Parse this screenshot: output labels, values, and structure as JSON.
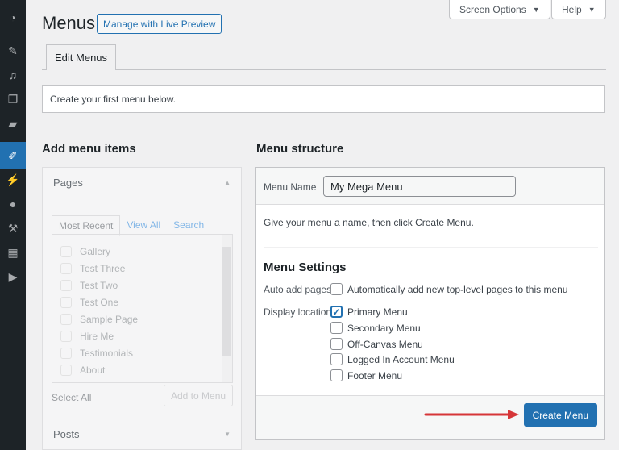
{
  "sidebar": {
    "items": [
      "dashboard-icon",
      "pin-icon",
      "media-icon",
      "pages-icon",
      "comments-icon",
      "appearance-icon",
      "plugins-icon",
      "users-icon",
      "tools-icon",
      "settings-icon",
      "play-icon"
    ]
  },
  "header": {
    "title": "Menus",
    "live_preview": "Manage with Live Preview",
    "screen_options": "Screen Options",
    "help": "Help"
  },
  "tabs": {
    "edit": "Edit Menus"
  },
  "notice": "Create your first menu below.",
  "add_items": {
    "title": "Add menu items",
    "pages": "Pages",
    "tabs": [
      "Most Recent",
      "View All",
      "Search"
    ],
    "pages_list": [
      "Gallery",
      "Test Three",
      "Test Two",
      "Test One",
      "Sample Page",
      "Hire Me",
      "Testimonials",
      "About"
    ],
    "select_all": "Select All",
    "add_to_menu": "Add to Menu",
    "posts": "Posts"
  },
  "structure": {
    "title": "Menu structure",
    "name_label": "Menu Name",
    "name_value": "My Mega Menu",
    "hint": "Give your menu a name, then click Create Menu.",
    "settings_title": "Menu Settings",
    "auto_add_label": "Auto add pages",
    "auto_add_text": "Automatically add new top-level pages to this menu",
    "display_label": "Display location",
    "locations": [
      {
        "label": "Primary Menu",
        "checked": true
      },
      {
        "label": "Secondary Menu",
        "checked": false
      },
      {
        "label": "Off-Canvas Menu",
        "checked": false
      },
      {
        "label": "Logged In Account Menu",
        "checked": false
      },
      {
        "label": "Footer Menu",
        "checked": false
      }
    ],
    "create": "Create Menu"
  },
  "colors": {
    "accent": "#2271b1",
    "arrow": "#d63638"
  }
}
